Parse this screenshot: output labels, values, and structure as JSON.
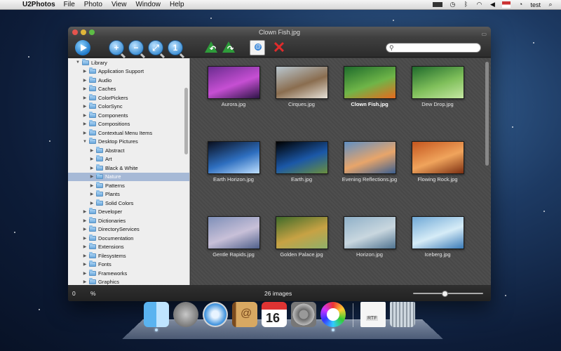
{
  "menubar": {
    "apple_glyph": "",
    "app_name": "U2Photos",
    "menus": [
      "File",
      "Photo",
      "View",
      "Window",
      "Help"
    ],
    "user": "test"
  },
  "window": {
    "title": "Clown Fish.jpg",
    "toolbar": {
      "zoom_in_label": "+",
      "zoom_out_label": "−",
      "zoom_fit_label": "⤢",
      "zoom_actual_label": "1",
      "email_label": "@",
      "delete_label": "✕",
      "search_placeholder": ""
    },
    "sidebar": {
      "items": [
        {
          "label": "Library",
          "level": 0,
          "expanded": true
        },
        {
          "label": "Application Support",
          "level": 1
        },
        {
          "label": "Audio",
          "level": 1
        },
        {
          "label": "Caches",
          "level": 1
        },
        {
          "label": "ColorPickers",
          "level": 1
        },
        {
          "label": "ColorSync",
          "level": 1
        },
        {
          "label": "Components",
          "level": 1
        },
        {
          "label": "Compositions",
          "level": 1
        },
        {
          "label": "Contextual Menu Items",
          "level": 1
        },
        {
          "label": "Desktop Pictures",
          "level": 1,
          "expanded": true
        },
        {
          "label": "Abstract",
          "level": 2
        },
        {
          "label": "Art",
          "level": 2
        },
        {
          "label": "Black & White",
          "level": 2
        },
        {
          "label": "Nature",
          "level": 2,
          "selected": true
        },
        {
          "label": "Patterns",
          "level": 2
        },
        {
          "label": "Plants",
          "level": 2
        },
        {
          "label": "Solid Colors",
          "level": 2
        },
        {
          "label": "Developer",
          "level": 1
        },
        {
          "label": "Dictionaries",
          "level": 1
        },
        {
          "label": "DirectoryServices",
          "level": 1
        },
        {
          "label": "Documentation",
          "level": 1
        },
        {
          "label": "Extensions",
          "level": 1
        },
        {
          "label": "Filesystems",
          "level": 1
        },
        {
          "label": "Fonts",
          "level": 1
        },
        {
          "label": "Frameworks",
          "level": 1
        },
        {
          "label": "Graphics",
          "level": 1
        }
      ]
    },
    "images": [
      {
        "name": "Aurora.jpg",
        "colors": [
          "#6a2c8f",
          "#c64fd3",
          "#2d1446"
        ]
      },
      {
        "name": "Cirques.jpg",
        "colors": [
          "#b9c7d0",
          "#8a6d4f",
          "#e6e1d8"
        ]
      },
      {
        "name": "Clown Fish.jpg",
        "colors": [
          "#1e6b2c",
          "#6fb548",
          "#e86a1e"
        ],
        "selected": true
      },
      {
        "name": "Dew Drop.jpg",
        "colors": [
          "#1f6a2c",
          "#7fbf5a",
          "#c5e7a3"
        ]
      },
      {
        "name": "Earth Horizon.jpg",
        "colors": [
          "#0a0f1e",
          "#2e6fc0",
          "#bfe0ff"
        ]
      },
      {
        "name": "Earth.jpg",
        "colors": [
          "#000000",
          "#1b58a8",
          "#6b8f3d"
        ]
      },
      {
        "name": "Evening Reflections.jpg",
        "colors": [
          "#5f8fc4",
          "#e8a56a",
          "#3b5f8f"
        ]
      },
      {
        "name": "Flowing Rock.jpg",
        "colors": [
          "#c4561e",
          "#f0a45c",
          "#7c2f12"
        ]
      },
      {
        "name": "Gentle Rapids.jpg",
        "colors": [
          "#7e8fb8",
          "#c8c0d8",
          "#4e5f8a"
        ]
      },
      {
        "name": "Golden Palace.jpg",
        "colors": [
          "#3f6b2a",
          "#c7a244",
          "#8fb06a"
        ]
      },
      {
        "name": "Horizon.jpg",
        "colors": [
          "#8fb0c8",
          "#c9d7df",
          "#4f7390"
        ]
      },
      {
        "name": "Iceberg.jpg",
        "colors": [
          "#6fa8d6",
          "#d6ecf7",
          "#3a7bb8"
        ]
      }
    ],
    "status": {
      "zoom_value": "0",
      "zoom_unit": "%",
      "count_text": "26 images",
      "thumb_size_fraction": 0.45
    }
  },
  "dock": {
    "items": [
      "finder-icon",
      "launchpad-icon",
      "safari-icon",
      "address-book-icon",
      "ical-icon",
      "system-preferences-icon",
      "u2photos-icon",
      "rtf-document-icon",
      "trash-icon"
    ],
    "ical_day": "16",
    "rtf_label": "RTF"
  }
}
